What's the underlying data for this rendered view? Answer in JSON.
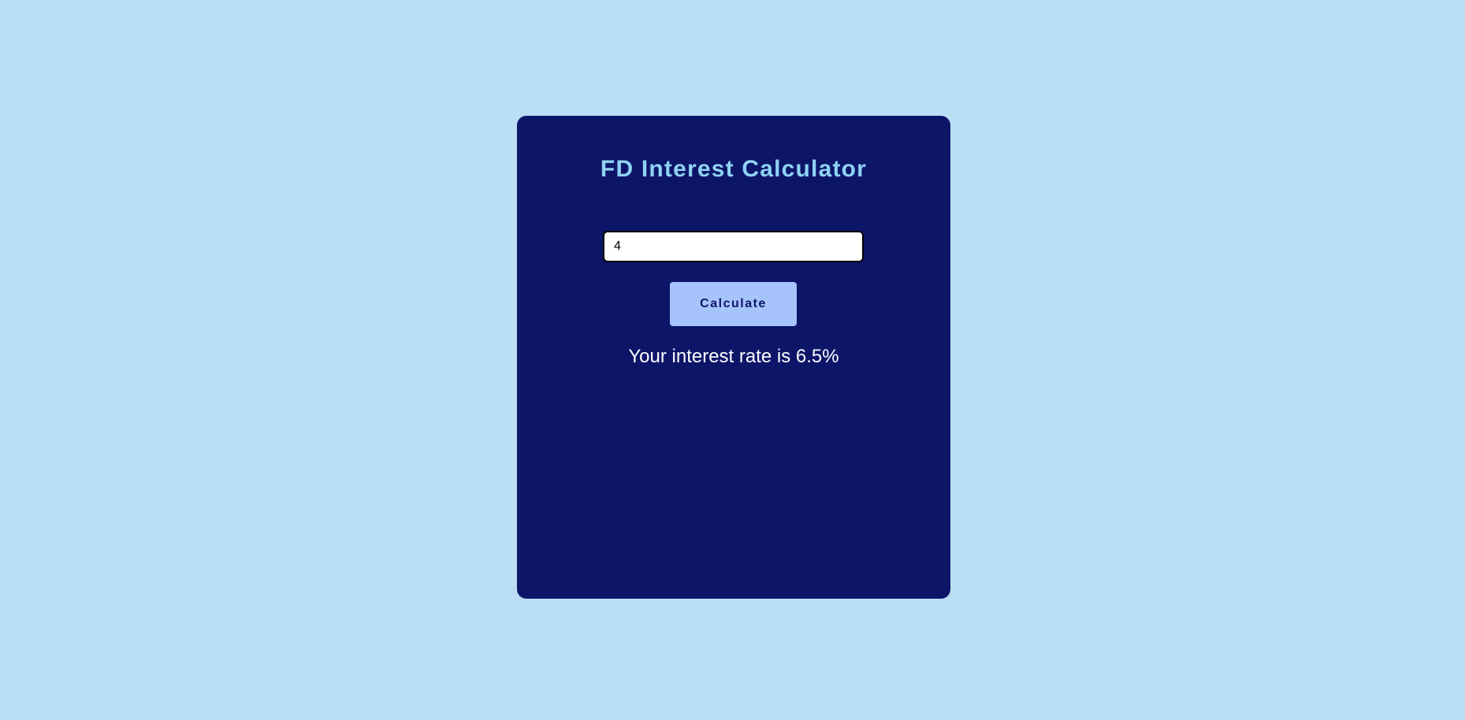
{
  "calculator": {
    "title": "FD Interest Calculator",
    "input_value": "4",
    "button_label": "Calculate",
    "result_text": "Your interest rate is 6.5%"
  },
  "colors": {
    "page_background": "#badef5",
    "card_background": "#0d1569",
    "title_color": "#8fd3f4",
    "button_background": "#a7c3fc",
    "button_text": "#0d1569",
    "result_text": "#ffffff"
  }
}
